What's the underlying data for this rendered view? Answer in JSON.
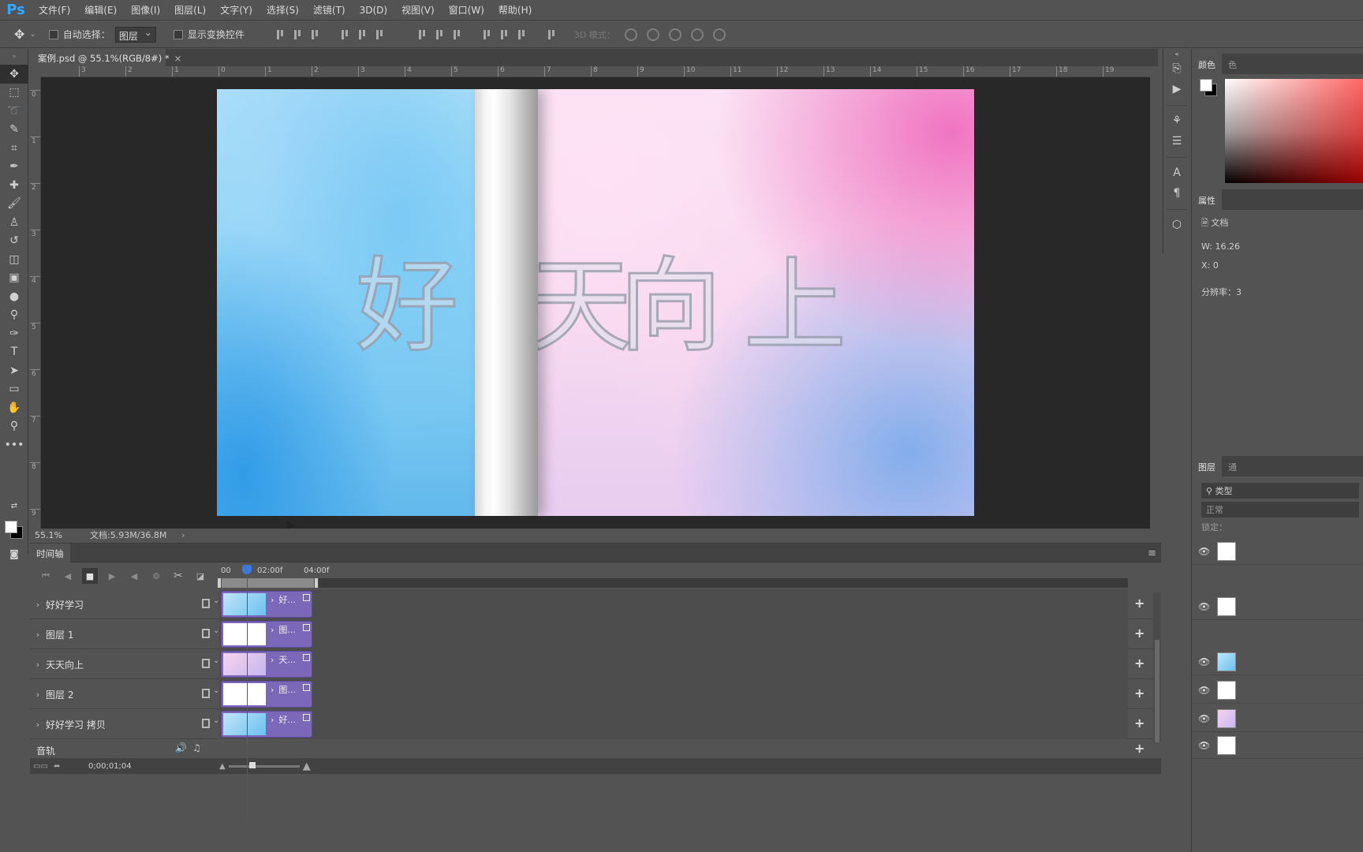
{
  "app": {
    "logo": "Ps",
    "menu": [
      "文件(F)",
      "编辑(E)",
      "图像(I)",
      "图层(L)",
      "文字(Y)",
      "选择(S)",
      "滤镜(T)",
      "3D(D)",
      "视图(V)",
      "窗口(W)",
      "帮助(H)"
    ]
  },
  "options": {
    "auto_select_label": "自动选择：",
    "auto_select_value": "图层",
    "show_transform_label": "显示变换控件",
    "mode3d_label": "3D 模式："
  },
  "document": {
    "tab_title": "案例.psd @ 55.1%(RGB/8#) *",
    "close_glyph": "×",
    "ruler_h": [
      "3",
      "2",
      "1",
      "0",
      "1",
      "2",
      "3",
      "4",
      "5",
      "6",
      "7",
      "8",
      "9",
      "10",
      "11",
      "12",
      "13",
      "14",
      "15",
      "16",
      "17",
      "18",
      "19"
    ],
    "ruler_v": [
      "0",
      "1",
      "2",
      "3",
      "4",
      "5",
      "6",
      "7",
      "8",
      "9"
    ],
    "artwork_text": [
      "好",
      "天",
      "向",
      "上"
    ]
  },
  "status": {
    "zoom": "55.1%",
    "doc_size": "文档:5.93M/36.8M",
    "arrow": "›"
  },
  "timeline": {
    "title": "时间轴",
    "menu_glyph": "≡",
    "times": [
      "00",
      "02:00f",
      "04:00f"
    ],
    "tracks": [
      {
        "name": "好好学习",
        "clip_label": "好...",
        "theme": "blue"
      },
      {
        "name": "图层 1",
        "clip_label": "图...",
        "theme": "white"
      },
      {
        "name": "天天向上",
        "clip_label": "天...",
        "theme": "pink"
      },
      {
        "name": "图层 2",
        "clip_label": "图...",
        "theme": "white"
      },
      {
        "name": "好好学习 拷贝",
        "clip_label": "好...",
        "theme": "blue"
      }
    ],
    "audio_label": "音轨",
    "timecode": "0;00;01;04",
    "add_glyph": "+",
    "track_chevron": "›"
  },
  "right_panels": {
    "color_tab": "颜色",
    "color_tab2": "色",
    "properties_tab": "属性",
    "properties_doc": "文档",
    "width_label": "W:",
    "width_value": "16.26",
    "x_label": "X:",
    "x_value": "0",
    "resolution_label": "分辨率：3",
    "layers_tab": "图层",
    "layers_tab2": "通",
    "layer_filter": "类型",
    "blend_mode": "正常",
    "lock_label": "锁定：",
    "layer_rows": [
      "白",
      "白",
      "蓝",
      "白",
      "粉",
      "白"
    ]
  },
  "colors": {
    "accent": "#31a8ff",
    "clip": "#7b68b8",
    "playhead": "#e02020"
  }
}
